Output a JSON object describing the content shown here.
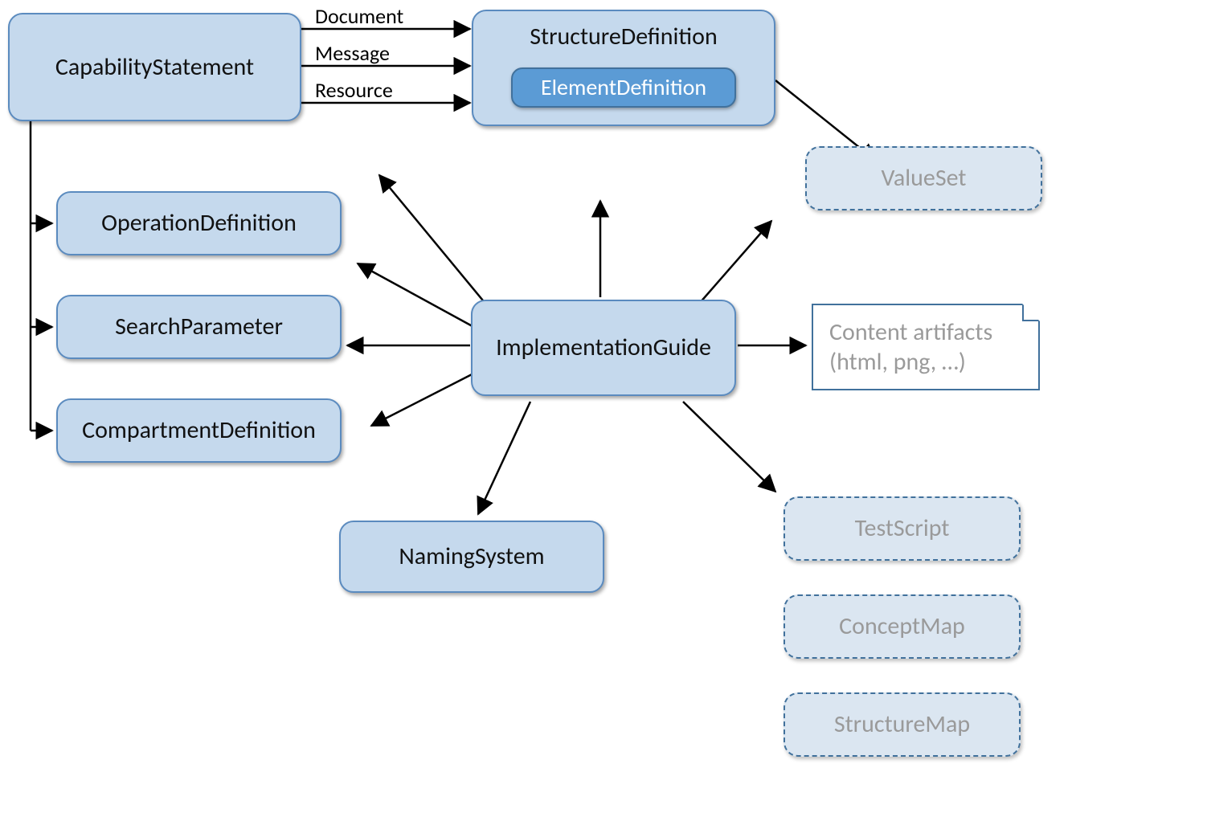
{
  "nodes": {
    "capabilityStatement": "CapabilityStatement",
    "structureDefinition": "StructureDefinition",
    "elementDefinition": "ElementDefinition",
    "operationDefinition": "OperationDefinition",
    "searchParameter": "SearchParameter",
    "compartmentDefinition": "CompartmentDefinition",
    "implementationGuide": "ImplementationGuide",
    "namingSystem": "NamingSystem",
    "valueSet": "ValueSet",
    "testScript": "TestScript",
    "conceptMap": "ConceptMap",
    "structureMap": "StructureMap",
    "contentArtifacts": "Content artifacts\n(html, png, …)"
  },
  "edgeLabels": {
    "document": "Document",
    "message": "Message",
    "resource": "Resource"
  }
}
